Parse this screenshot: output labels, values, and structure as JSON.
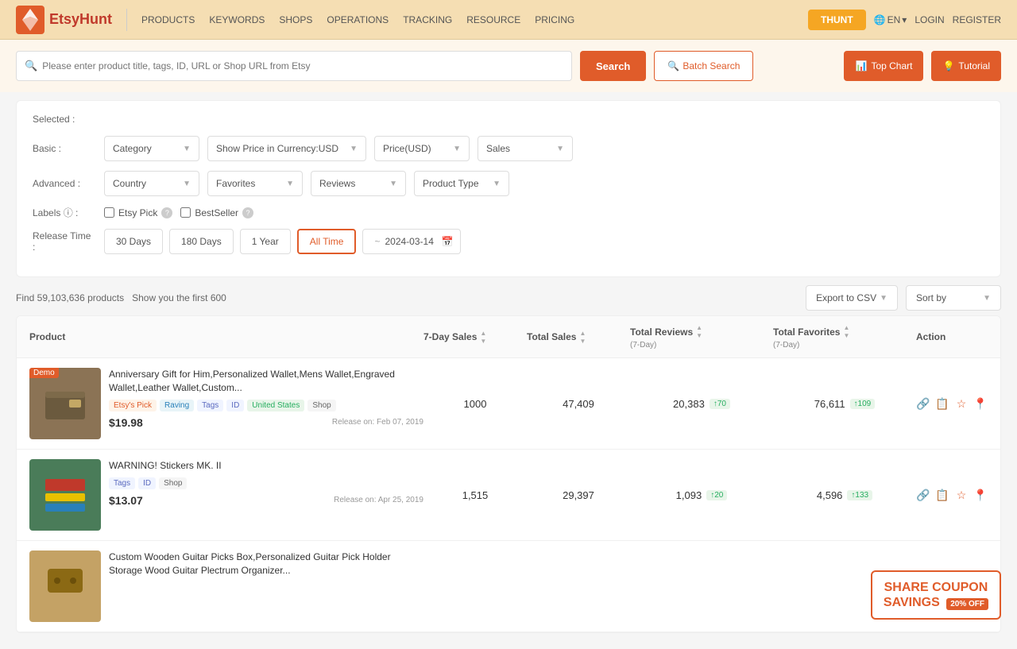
{
  "header": {
    "logo_text": "EtsyHunt",
    "nav_items": [
      {
        "label": "PRODUCTS",
        "has_dropdown": true
      },
      {
        "label": "KEYWORDS",
        "has_dropdown": true
      },
      {
        "label": "SHOPS",
        "has_dropdown": true
      },
      {
        "label": "OPERATIONS",
        "has_dropdown": true
      },
      {
        "label": "TRACKING",
        "has_dropdown": false
      },
      {
        "label": "RESOURCE",
        "has_dropdown": true
      },
      {
        "label": "PRICING",
        "has_dropdown": false
      }
    ],
    "thunt_btn": "THUNT",
    "lang_btn": "EN",
    "login_btn": "LOGIN",
    "register_btn": "REGISTER"
  },
  "search_bar": {
    "placeholder": "Please enter product title, tags, ID, URL or Shop URL from Etsy",
    "search_btn": "Search",
    "batch_search_btn": "Batch Search",
    "top_chart_btn": "Top Chart",
    "tutorial_btn": "Tutorial"
  },
  "filter_panel": {
    "selected_label": "Selected :",
    "basic_label": "Basic :",
    "advanced_label": "Advanced :",
    "labels_label": "Labels ⓘ :",
    "release_time_label": "Release Time :",
    "basic_filters": [
      {
        "label": "Category",
        "value": "Category"
      },
      {
        "label": "Show Price in Currency:USD",
        "value": "Show Price in Currency:USD"
      },
      {
        "label": "Price(USD)",
        "value": "Price(USD)"
      },
      {
        "label": "Sales",
        "value": "Sales"
      }
    ],
    "advanced_filters": [
      {
        "label": "Country",
        "value": "Country"
      },
      {
        "label": "Favorites",
        "value": "Favorites"
      },
      {
        "label": "Reviews",
        "value": "Reviews"
      },
      {
        "label": "Product Type",
        "value": "Product Type"
      }
    ],
    "labels": [
      {
        "id": "etsy-pick",
        "label": "Etsy Pick",
        "checked": false
      },
      {
        "id": "best-seller",
        "label": "BestSeller",
        "checked": false
      }
    ],
    "release_time_options": [
      "30 Days",
      "180 Days",
      "1 Year",
      "All Time"
    ],
    "active_time": "All Time",
    "date_from": "",
    "date_to": "2024-03-14"
  },
  "results": {
    "count_text": "Find 59,103,636 products",
    "limit_text": "Show you the first 600",
    "export_btn": "Export to CSV",
    "sort_btn": "Sort by"
  },
  "table": {
    "columns": [
      {
        "label": "Product",
        "sortable": false
      },
      {
        "label": "7-Day Sales",
        "sortable": true
      },
      {
        "label": "Total Sales",
        "sortable": true
      },
      {
        "label": "Total Reviews",
        "sub": "(7-Day)",
        "sortable": true
      },
      {
        "label": "Total Favorites",
        "sub": "(7-Day)",
        "sortable": true
      },
      {
        "label": "Action",
        "sortable": false
      }
    ],
    "rows": [
      {
        "demo": true,
        "img_type": "wallet",
        "title": "Anniversary Gift for Him,Personalized Wallet,Mens Wallet,Engraved Wallet,Leather Wallet,Custom...",
        "tags": [
          "Etsy's Pick",
          "Raving",
          "Tags",
          "ID",
          "United States",
          "Shop"
        ],
        "tag_types": [
          "etsy-pick",
          "raving",
          "tags",
          "id",
          "us",
          "shop"
        ],
        "price": "$19.98",
        "release": "Release on: Feb 07, 2019",
        "sales_7day": "1000",
        "total_sales": "47,409",
        "total_reviews": "20,383",
        "reviews_badge": "↑70",
        "total_favorites": "76,611",
        "favorites_badge": "↑109"
      },
      {
        "demo": false,
        "img_type": "sticker",
        "title": "WARNING! Stickers MK. II",
        "tags": [
          "Tags",
          "ID",
          "Shop"
        ],
        "tag_types": [
          "tags",
          "id",
          "shop"
        ],
        "price": "$13.07",
        "release": "Release on: Apr 25, 2019",
        "sales_7day": "1,515",
        "total_sales": "29,397",
        "total_reviews": "1,093",
        "reviews_badge": "↑20",
        "total_favorites": "4,596",
        "favorites_badge": "↑133"
      },
      {
        "demo": false,
        "img_type": "guitar",
        "title": "Custom Wooden Guitar Picks Box,Personalized Guitar Pick Holder Storage Wood Guitar Plectrum Organizer...",
        "tags": [],
        "tag_types": [],
        "price": "",
        "release": "",
        "sales_7day": "",
        "total_sales": "",
        "total_reviews": "",
        "reviews_badge": "",
        "total_favorites": "",
        "favorites_badge": ""
      }
    ]
  },
  "coupon": {
    "line1": "SHARE COUPON",
    "line2": "SAVINGS",
    "off_label": "20% OFF"
  }
}
